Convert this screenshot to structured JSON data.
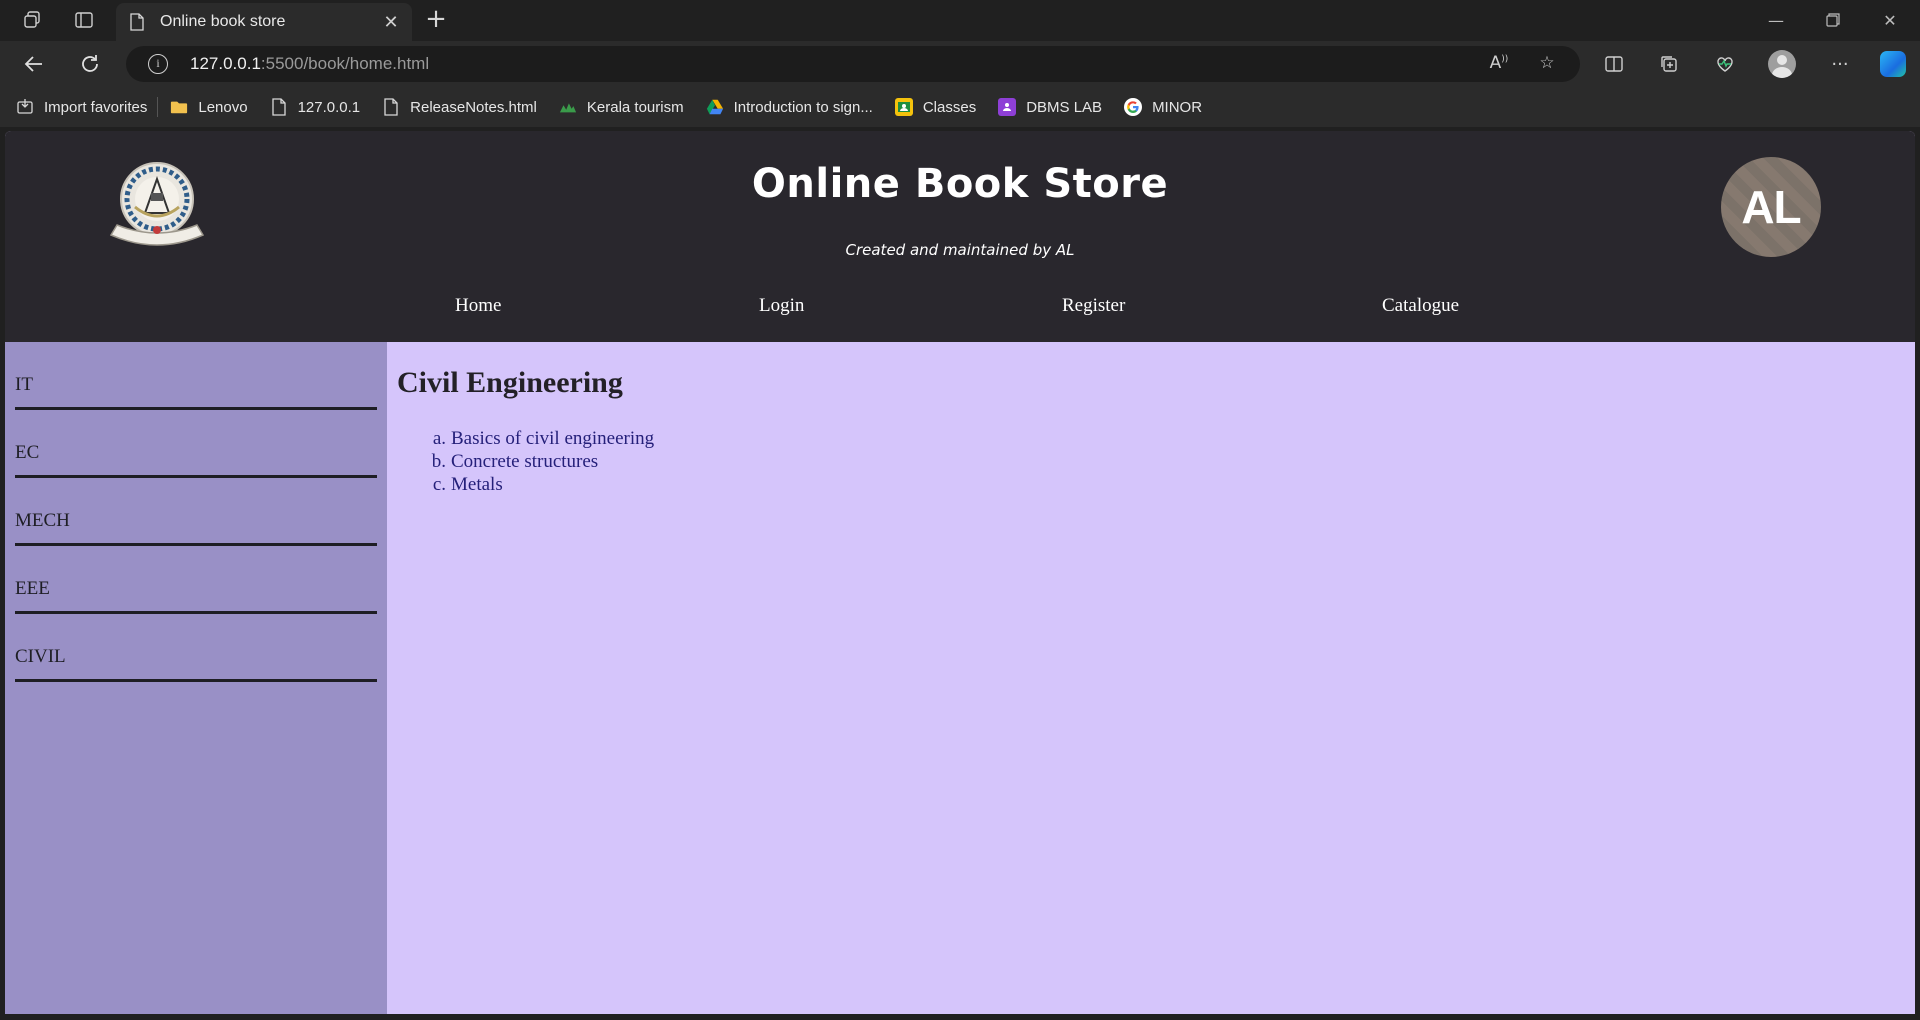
{
  "browser": {
    "tab_title": "Online book store",
    "url_host": "127.0.0.1",
    "url_rest": ":5500/book/home.html",
    "bookmarks": [
      {
        "label": "Import favorites",
        "icon": "import-icon"
      },
      {
        "label": "Lenovo",
        "icon": "folder-icon"
      },
      {
        "label": "127.0.0.1",
        "icon": "page-icon"
      },
      {
        "label": "ReleaseNotes.html",
        "icon": "page-icon"
      },
      {
        "label": "Kerala tourism",
        "icon": "kerala-icon"
      },
      {
        "label": "Introduction to sign...",
        "icon": "drive-icon"
      },
      {
        "label": "Classes",
        "icon": "classroom-icon"
      },
      {
        "label": "DBMS LAB",
        "icon": "classroom-purple-icon"
      },
      {
        "label": "MINOR",
        "icon": "google-icon"
      }
    ]
  },
  "site": {
    "title": "Online Book Store",
    "subtitle": "Created and maintained by AL",
    "avatar_text": "AL",
    "nav": [
      "Home",
      "Login",
      "Register",
      "Catalogue"
    ]
  },
  "sidebar": {
    "items": [
      "IT",
      "EC",
      "MECH",
      "EEE",
      "CIVIL"
    ]
  },
  "content": {
    "heading": "Civil Engineering",
    "books": [
      {
        "marker": "a.",
        "title": "Basics of civil engineering"
      },
      {
        "marker": "b.",
        "title": "Concrete structures"
      },
      {
        "marker": "c.",
        "title": "Metals"
      }
    ]
  },
  "colors": {
    "header_bg": "#29272d",
    "sidebar_bg": "#9990c6",
    "content_bg": "#d5c5fb",
    "link_color": "#25207a"
  }
}
